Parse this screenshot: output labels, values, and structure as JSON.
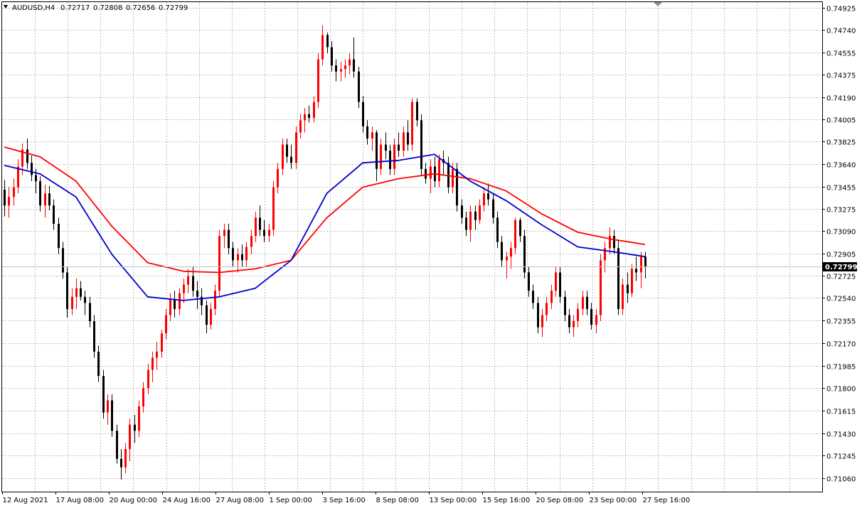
{
  "chart_data": {
    "type": "candlestick",
    "title": "AUDUSD,H4",
    "ohlc_text": [
      "0.72717",
      "0.72808",
      "0.72656",
      "0.72799"
    ],
    "current_price": "0.72799",
    "y_ticks": [
      "0.74925",
      "0.74740",
      "0.74555",
      "0.74375",
      "0.74190",
      "0.74005",
      "0.73825",
      "0.73640",
      "0.73455",
      "0.73275",
      "0.73090",
      "0.72905",
      "0.72725",
      "0.72540",
      "0.72355",
      "0.72170",
      "0.71985",
      "0.71800",
      "0.71615",
      "0.71430",
      "0.71245",
      "0.71060"
    ],
    "x_ticks": [
      "12 Aug 2021",
      "17 Aug 08:00",
      "20 Aug 00:00",
      "24 Aug 16:00",
      "27 Aug 08:00",
      "1 Sep 00:00",
      "3 Sep 16:00",
      "8 Sep 08:00",
      "13 Sep 00:00",
      "15 Sep 16:00",
      "20 Sep 08:00",
      "23 Sep 00:00",
      "27 Sep 16:00"
    ],
    "ylim": [
      0.7095,
      0.7497
    ],
    "grid": true,
    "colors": {
      "bull": "#ff0000",
      "bear": "#000000",
      "ma_fast": "#0000c8",
      "ma_slow": "#ff0000",
      "price_line": "#c0c0c0",
      "grid": "#c0c0c0",
      "price_label_bg": "#000000",
      "price_label_text": "#ffffff"
    },
    "candles": [
      [
        0.7343,
        0.7351,
        0.7321,
        0.733
      ],
      [
        0.733,
        0.7345,
        0.732,
        0.7337
      ],
      [
        0.7337,
        0.7352,
        0.733,
        0.7345
      ],
      [
        0.7345,
        0.7368,
        0.734,
        0.7362
      ],
      [
        0.7362,
        0.7381,
        0.7355,
        0.7376
      ],
      [
        0.7376,
        0.7385,
        0.736,
        0.7365
      ],
      [
        0.7365,
        0.7371,
        0.735,
        0.7355
      ],
      [
        0.7355,
        0.736,
        0.734,
        0.735
      ],
      [
        0.735,
        0.7354,
        0.7325,
        0.733
      ],
      [
        0.733,
        0.7347,
        0.732,
        0.734
      ],
      [
        0.734,
        0.7346,
        0.7326,
        0.733
      ],
      [
        0.733,
        0.7335,
        0.731,
        0.7315
      ],
      [
        0.7315,
        0.732,
        0.729,
        0.7295
      ],
      [
        0.7295,
        0.73,
        0.727,
        0.7275
      ],
      [
        0.7275,
        0.728,
        0.7238,
        0.7245
      ],
      [
        0.7245,
        0.7262,
        0.724,
        0.7255
      ],
      [
        0.7255,
        0.727,
        0.7245,
        0.7262
      ],
      [
        0.7262,
        0.7268,
        0.7252,
        0.7255
      ],
      [
        0.7255,
        0.726,
        0.724,
        0.725
      ],
      [
        0.725,
        0.7255,
        0.723,
        0.7235
      ],
      [
        0.7235,
        0.724,
        0.7205,
        0.721
      ],
      [
        0.721,
        0.7215,
        0.7185,
        0.719
      ],
      [
        0.719,
        0.7195,
        0.7155,
        0.716
      ],
      [
        0.716,
        0.7175,
        0.715,
        0.717
      ],
      [
        0.717,
        0.7175,
        0.714,
        0.7145
      ],
      [
        0.7145,
        0.715,
        0.7118,
        0.7122
      ],
      [
        0.7122,
        0.713,
        0.7105,
        0.7115
      ],
      [
        0.7115,
        0.7135,
        0.711,
        0.713
      ],
      [
        0.713,
        0.7155,
        0.712,
        0.715
      ],
      [
        0.715,
        0.7158,
        0.7135,
        0.7145
      ],
      [
        0.7145,
        0.717,
        0.714,
        0.7165
      ],
      [
        0.7165,
        0.7185,
        0.716,
        0.718
      ],
      [
        0.718,
        0.72,
        0.7175,
        0.7195
      ],
      [
        0.7195,
        0.721,
        0.7185,
        0.7205
      ],
      [
        0.7205,
        0.7218,
        0.7195,
        0.721
      ],
      [
        0.721,
        0.7228,
        0.7205,
        0.7225
      ],
      [
        0.7225,
        0.7245,
        0.722,
        0.724
      ],
      [
        0.724,
        0.7258,
        0.7235,
        0.7253
      ],
      [
        0.7253,
        0.726,
        0.7238,
        0.7245
      ],
      [
        0.7245,
        0.7262,
        0.724,
        0.7258
      ],
      [
        0.7258,
        0.727,
        0.725,
        0.7265
      ],
      [
        0.7265,
        0.7278,
        0.7258,
        0.7272
      ],
      [
        0.7272,
        0.728,
        0.7255,
        0.726
      ],
      [
        0.726,
        0.7268,
        0.7245,
        0.7255
      ],
      [
        0.7255,
        0.7262,
        0.724,
        0.7248
      ],
      [
        0.7248,
        0.7252,
        0.7225,
        0.7232
      ],
      [
        0.7232,
        0.725,
        0.7228,
        0.7245
      ],
      [
        0.7245,
        0.7265,
        0.724,
        0.726
      ],
      [
        0.726,
        0.731,
        0.7255,
        0.7305
      ],
      [
        0.7305,
        0.7315,
        0.7295,
        0.731
      ],
      [
        0.731,
        0.7315,
        0.729,
        0.7295
      ],
      [
        0.7295,
        0.73,
        0.728,
        0.7285
      ],
      [
        0.7285,
        0.7295,
        0.7275,
        0.729
      ],
      [
        0.729,
        0.7298,
        0.728,
        0.7285
      ],
      [
        0.7285,
        0.73,
        0.728,
        0.7296
      ],
      [
        0.7296,
        0.731,
        0.729,
        0.7305
      ],
      [
        0.7305,
        0.7325,
        0.73,
        0.732
      ],
      [
        0.732,
        0.733,
        0.7305,
        0.731
      ],
      [
        0.731,
        0.7318,
        0.73,
        0.7305
      ],
      [
        0.7305,
        0.7315,
        0.73,
        0.731
      ],
      [
        0.731,
        0.735,
        0.7305,
        0.7345
      ],
      [
        0.7345,
        0.7365,
        0.734,
        0.736
      ],
      [
        0.736,
        0.7385,
        0.7355,
        0.738
      ],
      [
        0.738,
        0.7385,
        0.7365,
        0.737
      ],
      [
        0.737,
        0.738,
        0.736,
        0.7365
      ],
      [
        0.7365,
        0.7395,
        0.736,
        0.739
      ],
      [
        0.739,
        0.7405,
        0.7385,
        0.74
      ],
      [
        0.74,
        0.741,
        0.739,
        0.7405
      ],
      [
        0.7405,
        0.7412,
        0.7398,
        0.7402
      ],
      [
        0.7402,
        0.742,
        0.7398,
        0.7415
      ],
      [
        0.7415,
        0.7455,
        0.741,
        0.745
      ],
      [
        0.745,
        0.7478,
        0.7445,
        0.747
      ],
      [
        0.747,
        0.7472,
        0.7455,
        0.746
      ],
      [
        0.746,
        0.7465,
        0.744,
        0.7445
      ],
      [
        0.7445,
        0.745,
        0.7432,
        0.744
      ],
      [
        0.744,
        0.7448,
        0.7432,
        0.7442
      ],
      [
        0.7442,
        0.745,
        0.7435,
        0.7445
      ],
      [
        0.7445,
        0.7455,
        0.7438,
        0.745
      ],
      [
        0.745,
        0.7468,
        0.7435,
        0.744
      ],
      [
        0.744,
        0.7444,
        0.741,
        0.7415
      ],
      [
        0.7415,
        0.742,
        0.739,
        0.7395
      ],
      [
        0.7395,
        0.74,
        0.738,
        0.7385
      ],
      [
        0.7385,
        0.7395,
        0.7375,
        0.739
      ],
      [
        0.739,
        0.7392,
        0.735,
        0.736
      ],
      [
        0.736,
        0.7385,
        0.7355,
        0.738
      ],
      [
        0.738,
        0.739,
        0.7368,
        0.7375
      ],
      [
        0.7375,
        0.738,
        0.7355,
        0.736
      ],
      [
        0.736,
        0.7385,
        0.7355,
        0.738
      ],
      [
        0.738,
        0.739,
        0.737,
        0.7375
      ],
      [
        0.7375,
        0.7395,
        0.737,
        0.739
      ],
      [
        0.739,
        0.74,
        0.7375,
        0.738
      ],
      [
        0.738,
        0.7418,
        0.7375,
        0.7415
      ],
      [
        0.7415,
        0.7418,
        0.7395,
        0.74
      ],
      [
        0.74,
        0.7405,
        0.7355,
        0.736
      ],
      [
        0.736,
        0.7365,
        0.7348,
        0.7352
      ],
      [
        0.7352,
        0.7368,
        0.734,
        0.7362
      ],
      [
        0.7362,
        0.737,
        0.7345,
        0.735
      ],
      [
        0.735,
        0.7372,
        0.7345,
        0.7368
      ],
      [
        0.7368,
        0.7375,
        0.7355,
        0.7365
      ],
      [
        0.7365,
        0.737,
        0.734,
        0.7345
      ],
      [
        0.7345,
        0.7365,
        0.734,
        0.736
      ],
      [
        0.736,
        0.7365,
        0.7325,
        0.733
      ],
      [
        0.733,
        0.7335,
        0.7315,
        0.732
      ],
      [
        0.732,
        0.7325,
        0.7305,
        0.731
      ],
      [
        0.731,
        0.733,
        0.73,
        0.7325
      ],
      [
        0.7325,
        0.733,
        0.731,
        0.7318
      ],
      [
        0.7318,
        0.7335,
        0.7315,
        0.733
      ],
      [
        0.733,
        0.7345,
        0.7325,
        0.734
      ],
      [
        0.734,
        0.7348,
        0.733,
        0.7335
      ],
      [
        0.7335,
        0.734,
        0.7315,
        0.732
      ],
      [
        0.732,
        0.7325,
        0.7295,
        0.73
      ],
      [
        0.73,
        0.7305,
        0.728,
        0.7285
      ],
      [
        0.7285,
        0.7292,
        0.727,
        0.7288
      ],
      [
        0.7288,
        0.73,
        0.7278,
        0.7295
      ],
      [
        0.7295,
        0.732,
        0.729,
        0.7318
      ],
      [
        0.7318,
        0.732,
        0.73,
        0.7305
      ],
      [
        0.7305,
        0.731,
        0.727,
        0.7275
      ],
      [
        0.7275,
        0.728,
        0.7255,
        0.726
      ],
      [
        0.726,
        0.7265,
        0.7245,
        0.725
      ],
      [
        0.725,
        0.7255,
        0.7225,
        0.723
      ],
      [
        0.723,
        0.7245,
        0.7222,
        0.724
      ],
      [
        0.724,
        0.7255,
        0.7235,
        0.725
      ],
      [
        0.725,
        0.7265,
        0.7245,
        0.726
      ],
      [
        0.726,
        0.728,
        0.7255,
        0.7275
      ],
      [
        0.7275,
        0.728,
        0.725,
        0.7255
      ],
      [
        0.7255,
        0.726,
        0.7235,
        0.724
      ],
      [
        0.724,
        0.7245,
        0.7225,
        0.723
      ],
      [
        0.723,
        0.724,
        0.7222,
        0.7235
      ],
      [
        0.7235,
        0.725,
        0.723,
        0.7245
      ],
      [
        0.7245,
        0.726,
        0.724,
        0.7255
      ],
      [
        0.7255,
        0.726,
        0.724,
        0.7245
      ],
      [
        0.7245,
        0.725,
        0.7228,
        0.7232
      ],
      [
        0.7232,
        0.7245,
        0.7225,
        0.724
      ],
      [
        0.724,
        0.729,
        0.7235,
        0.7285
      ],
      [
        0.7285,
        0.73,
        0.7275,
        0.7295
      ],
      [
        0.7295,
        0.7312,
        0.729,
        0.7305
      ],
      [
        0.7305,
        0.731,
        0.729,
        0.7295
      ],
      [
        0.7295,
        0.7302,
        0.724,
        0.7245
      ],
      [
        0.7245,
        0.727,
        0.724,
        0.7265
      ],
      [
        0.7265,
        0.7275,
        0.725,
        0.7258
      ],
      [
        0.7258,
        0.7282,
        0.7255,
        0.7278
      ],
      [
        0.7278,
        0.7288,
        0.7268,
        0.7275
      ],
      [
        0.7275,
        0.7292,
        0.7262,
        0.7288
      ],
      [
        0.7288,
        0.7292,
        0.727,
        0.728
      ]
    ],
    "ma_fast": [
      [
        0,
        0.7363
      ],
      [
        8,
        0.7356
      ],
      [
        16,
        0.7337
      ],
      [
        24,
        0.729
      ],
      [
        32,
        0.7255
      ],
      [
        40,
        0.7252
      ],
      [
        48,
        0.7255
      ],
      [
        56,
        0.7262
      ],
      [
        64,
        0.7285
      ],
      [
        72,
        0.734
      ],
      [
        80,
        0.7365
      ],
      [
        88,
        0.7367
      ],
      [
        96,
        0.7372
      ],
      [
        104,
        0.735
      ],
      [
        112,
        0.7334
      ],
      [
        120,
        0.7314
      ],
      [
        128,
        0.7296
      ],
      [
        136,
        0.7292
      ],
      [
        143,
        0.7288
      ]
    ],
    "ma_slow": [
      [
        0,
        0.7378
      ],
      [
        8,
        0.737
      ],
      [
        16,
        0.735
      ],
      [
        24,
        0.7313
      ],
      [
        32,
        0.7283
      ],
      [
        40,
        0.7276
      ],
      [
        48,
        0.7275
      ],
      [
        56,
        0.7278
      ],
      [
        64,
        0.7285
      ],
      [
        72,
        0.732
      ],
      [
        80,
        0.7345
      ],
      [
        88,
        0.7352
      ],
      [
        96,
        0.7356
      ],
      [
        104,
        0.7352
      ],
      [
        112,
        0.7342
      ],
      [
        120,
        0.7323
      ],
      [
        128,
        0.7308
      ],
      [
        136,
        0.7302
      ],
      [
        143,
        0.7298
      ]
    ]
  }
}
